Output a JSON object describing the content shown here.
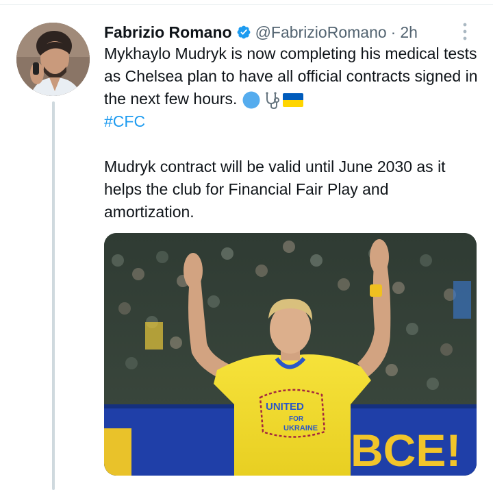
{
  "author": {
    "name": "Fabrizio Romano",
    "handle": "@FabrizioRomano",
    "separator": "·",
    "time": "2h"
  },
  "tweet": {
    "paragraph1": "Mykhaylo Mudryk is now completing his medical tests as Chelsea plan to have all official contracts signed in the next few hours.",
    "hashtag": "#CFC",
    "paragraph2": "Mudryk contract will be valid until June 2030 as it helps the club for Financial Fair Play and amortization."
  },
  "media": {
    "shirt_text_line1": "UNITED",
    "shirt_text_line2": "FOR",
    "shirt_text_line3": "UKRAINE",
    "billboard_text": "BCE!"
  },
  "colors": {
    "link": "#1d9bf0",
    "verified": "#1d9bf0",
    "text": "#0f1419",
    "muted": "#536471"
  },
  "icons": [
    "verified-badge-icon",
    "more-options-icon",
    "blue-circle-emoji",
    "stethoscope-emoji",
    "ukraine-flag-emoji"
  ]
}
